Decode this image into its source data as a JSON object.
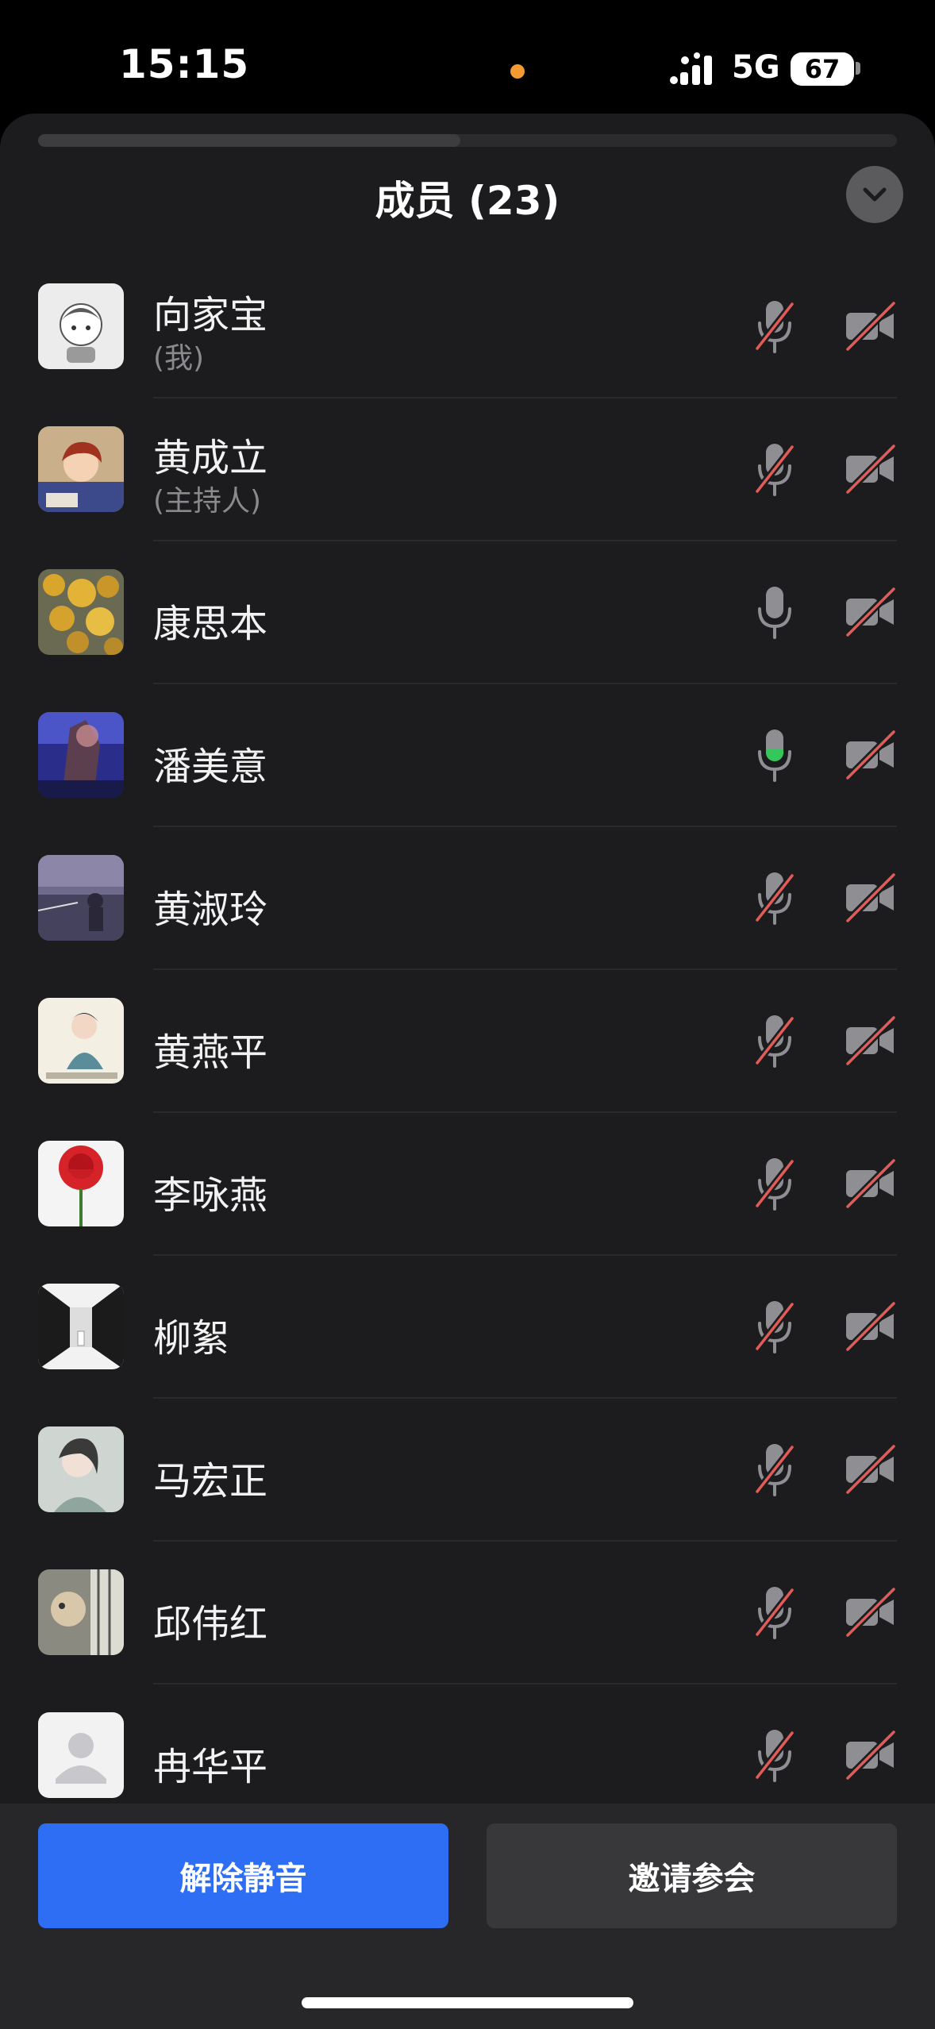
{
  "status_bar": {
    "time": "15:15",
    "network": "5G",
    "battery": "67",
    "dot_color": "#f39a33"
  },
  "header": {
    "title": "成员 (23)",
    "collapse_icon": "chevron-down-icon"
  },
  "members": [
    {
      "name": "向家宝",
      "role": "(我)",
      "mic": "muted",
      "camera": "off",
      "avatar": "cartoon-boy"
    },
    {
      "name": "黄成立",
      "role": "(主持人)",
      "mic": "muted",
      "camera": "off",
      "avatar": "anime-boy"
    },
    {
      "name": "康思本",
      "role": "",
      "mic": "on",
      "camera": "off",
      "avatar": "yellow-flowers"
    },
    {
      "name": "潘美意",
      "role": "",
      "mic": "speaking",
      "camera": "off",
      "avatar": "night-trees"
    },
    {
      "name": "黄淑玲",
      "role": "",
      "mic": "muted",
      "camera": "off",
      "avatar": "sunset-girl"
    },
    {
      "name": "黄燕平",
      "role": "",
      "mic": "muted",
      "camera": "off",
      "avatar": "painting-lady"
    },
    {
      "name": "李咏燕",
      "role": "",
      "mic": "muted",
      "camera": "off",
      "avatar": "red-rose"
    },
    {
      "name": "柳絮",
      "role": "",
      "mic": "muted",
      "camera": "off",
      "avatar": "corridor"
    },
    {
      "name": "马宏正",
      "role": "",
      "mic": "muted",
      "camera": "off",
      "avatar": "portrait-girl"
    },
    {
      "name": "邱伟红",
      "role": "",
      "mic": "muted",
      "camera": "off",
      "avatar": "window-cat"
    },
    {
      "name": "冉华平",
      "role": "",
      "mic": "muted",
      "camera": "off",
      "avatar": "default-person"
    }
  ],
  "actions": {
    "unmute_label": "解除静音",
    "invite_label": "邀请参会"
  },
  "colors": {
    "accent": "#2e6ef5",
    "muted_slash": "#e25b57",
    "speaking": "#34c759",
    "icon_gray": "#8e8e93"
  }
}
